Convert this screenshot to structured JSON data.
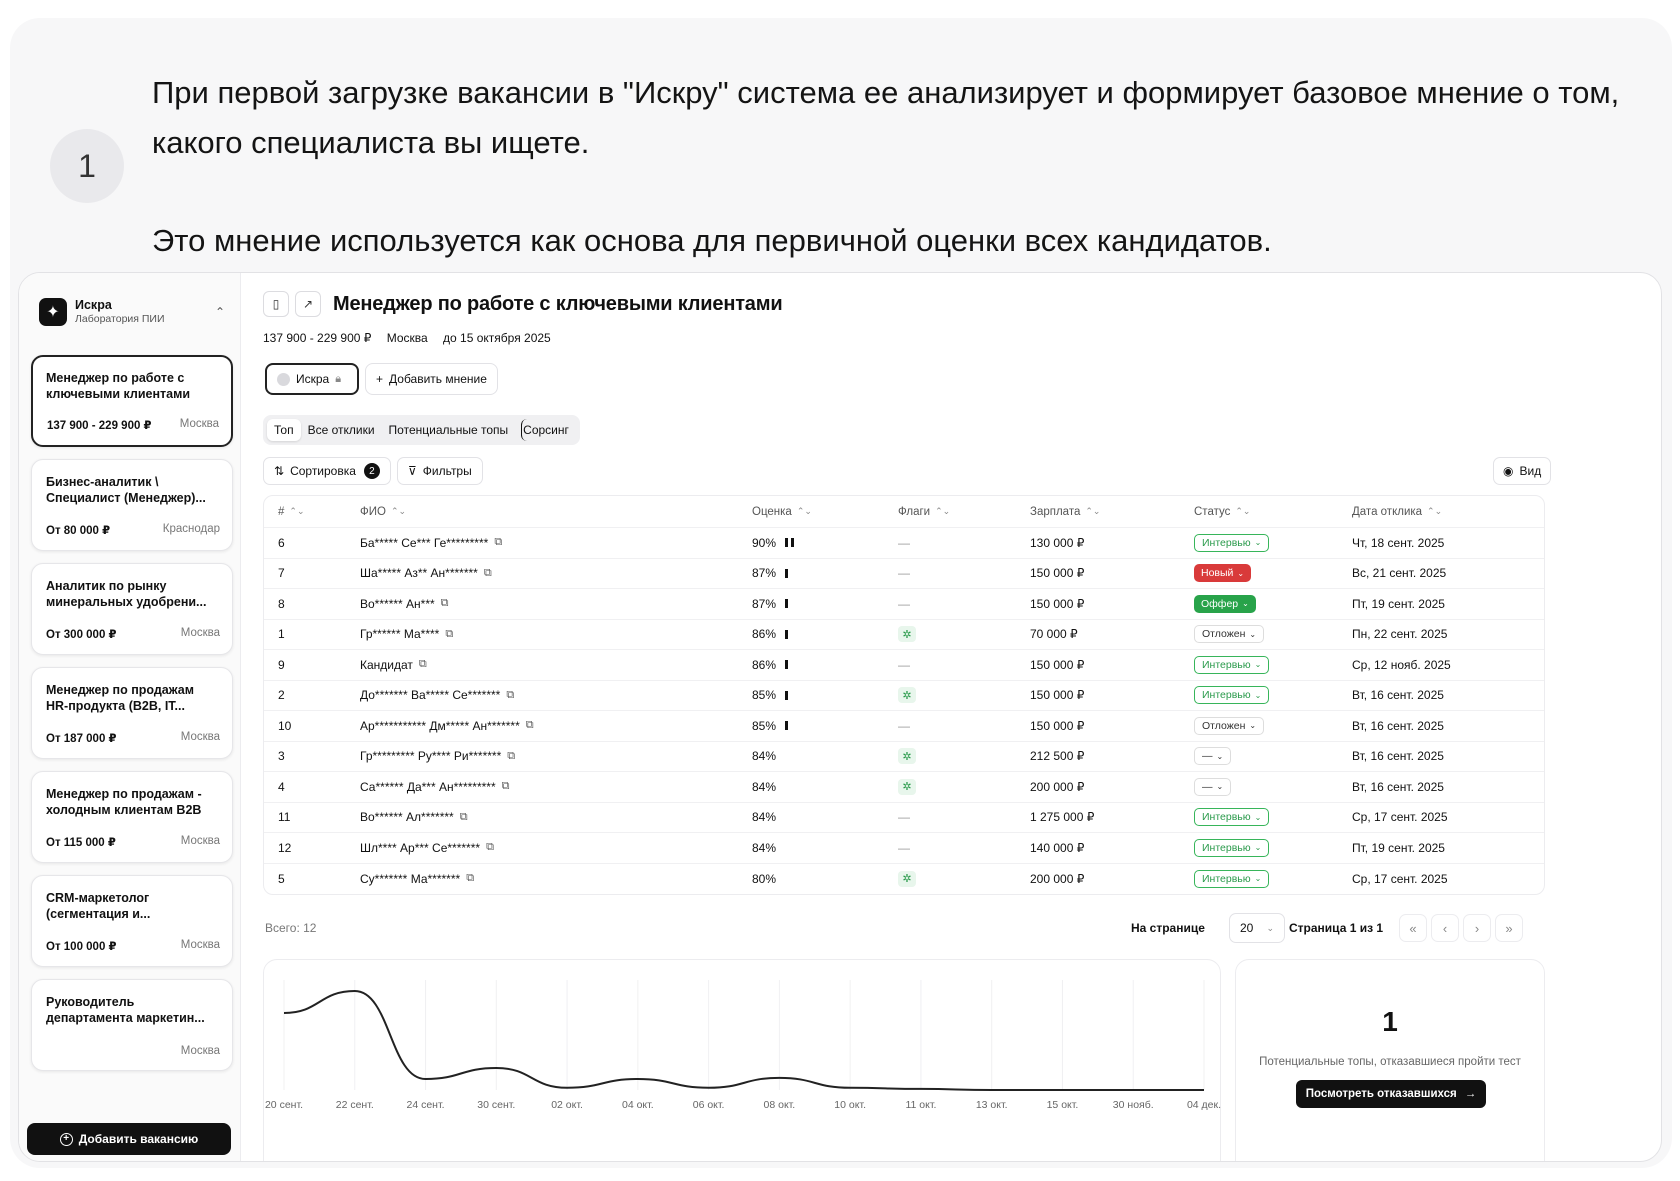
{
  "step": {
    "number": "1"
  },
  "intro": {
    "line1": "При первой загрузке вакансии в \"Искру\" система ее анализирует и формирует базовое мнение о том, какого специалиста вы ищете.",
    "line2": "Это мнение используется как основа для первичной оценки всех кандидатов."
  },
  "workspace": {
    "name": "Искра",
    "org": "Лаборатория ПИИ",
    "switch_icon": "chevrons-up-down-icon"
  },
  "vacancies": [
    {
      "title": "Менеджер по работе с ключевыми клиентами",
      "salary": "137 900 - 229 900 ₽",
      "city": "Москва",
      "active": true
    },
    {
      "title": "Бизнес-аналитик \\ Специалист (Менеджер)...",
      "salary": "От 80 000 ₽",
      "city": "Краснодар"
    },
    {
      "title": "Аналитик по рынку минеральных удобрени...",
      "salary": "От 300 000 ₽",
      "city": "Москва"
    },
    {
      "title": "Менеджер по продажам HR-продукта (B2B, IT...",
      "salary": "От 187 000 ₽",
      "city": "Москва"
    },
    {
      "title": "Менеджер по продажам - холодным клиентам B2B",
      "salary": "От 115 000 ₽",
      "city": "Москва"
    },
    {
      "title": "CRM-маркетолог (сегментация и...",
      "salary": "От 100 000 ₽",
      "city": "Москва"
    },
    {
      "title": "Руководитель департамента маркетин...",
      "salary": "",
      "city": "Москва"
    }
  ],
  "add_vacancy_label": "Добавить вакансию",
  "job": {
    "title": "Менеджер по работе с ключевыми клиентами",
    "salary": "137 900 - 229 900 ₽",
    "city": "Москва",
    "deadline": "до 15 октября 2025"
  },
  "opinions": {
    "selected": "Искра",
    "add_label": "Добавить мнение"
  },
  "tabs": [
    "Топ",
    "Все отклики",
    "Потенциальные топы",
    "Сорсинг"
  ],
  "controls": {
    "sort_label": "Сортировка",
    "sort_count": "2",
    "filter_label": "Фильтры",
    "view_label": "Вид"
  },
  "colors": {
    "interview": "#2a9a4b",
    "new": "#d93a3a",
    "offer": "#28a34a"
  },
  "table": {
    "headers": [
      "#",
      "ФИО",
      "Оценка",
      "Флаги",
      "Зарплата",
      "Статус",
      "Дата отклика"
    ],
    "rows": [
      {
        "n": "6",
        "name": "Ба***** Се*** Ге*********",
        "score": "90%",
        "bars": 2,
        "flag": false,
        "salary": "130 000 ₽",
        "status": "Интервью",
        "kind": "interview",
        "date": "Чт, 18 сент. 2025"
      },
      {
        "n": "7",
        "name": "Ша***** Аз** Ан*******",
        "score": "87%",
        "bars": 1,
        "flag": false,
        "salary": "150 000 ₽",
        "status": "Новый",
        "kind": "new",
        "date": "Вс, 21 сент. 2025"
      },
      {
        "n": "8",
        "name": "Во****** Ан***",
        "score": "87%",
        "bars": 1,
        "flag": false,
        "salary": "150 000 ₽",
        "status": "Оффер",
        "kind": "offer",
        "date": "Пт, 19 сент. 2025"
      },
      {
        "n": "1",
        "name": "Гр****** Ма****",
        "score": "86%",
        "bars": 1,
        "flag": true,
        "salary": "70 000 ₽",
        "status": "Отложен",
        "kind": "deferred",
        "date": "Пн, 22 сент. 2025"
      },
      {
        "n": "9",
        "name": "Кандидат",
        "score": "86%",
        "bars": 1,
        "flag": false,
        "salary": "150 000 ₽",
        "status": "Интервью",
        "kind": "interview",
        "date": "Ср, 12 нояб. 2025"
      },
      {
        "n": "2",
        "name": "До******* Ва***** Се*******",
        "score": "85%",
        "bars": 1,
        "flag": true,
        "salary": "150 000 ₽",
        "status": "Интервью",
        "kind": "interview",
        "date": "Вт, 16 сент. 2025"
      },
      {
        "n": "10",
        "name": "Ар*********** Дм***** Ан*******",
        "score": "85%",
        "bars": 1,
        "flag": false,
        "salary": "150 000 ₽",
        "status": "Отложен",
        "kind": "deferred",
        "date": "Вт, 16 сент. 2025"
      },
      {
        "n": "3",
        "name": "Гр********* Ру**** Ри*******",
        "score": "84%",
        "bars": 0,
        "flag": true,
        "salary": "212 500 ₽",
        "status": "—",
        "kind": "none",
        "date": "Вт, 16 сент. 2025"
      },
      {
        "n": "4",
        "name": "Са****** Да*** Ан*********",
        "score": "84%",
        "bars": 0,
        "flag": true,
        "salary": "200 000 ₽",
        "status": "—",
        "kind": "none",
        "date": "Вт, 16 сент. 2025"
      },
      {
        "n": "11",
        "name": "Во****** Ал*******",
        "score": "84%",
        "bars": 0,
        "flag": false,
        "salary": "1 275 000 ₽",
        "status": "Интервью",
        "kind": "interview",
        "date": "Ср, 17 сент. 2025"
      },
      {
        "n": "12",
        "name": "Шл**** Ар*** Се*******",
        "score": "84%",
        "bars": 0,
        "flag": false,
        "salary": "140 000 ₽",
        "status": "Интервью",
        "kind": "interview",
        "date": "Пт, 19 сент. 2025"
      },
      {
        "n": "5",
        "name": "Су******* Ма*******",
        "score": "80%",
        "bars": 0,
        "flag": true,
        "salary": "200 000 ₽",
        "status": "Интервью",
        "kind": "interview",
        "date": "Ср, 17 сент. 2025"
      }
    ]
  },
  "footer": {
    "total": "Всего: 12",
    "per_page_label": "На странице",
    "per_page": "20",
    "page_info": "Страница 1 из 1"
  },
  "chart_data": {
    "type": "line",
    "x": [
      "20 сент.",
      "22 сент.",
      "24 сент.",
      "30 сент.",
      "02 окт.",
      "04 окт.",
      "06 окт.",
      "08 окт.",
      "10 окт.",
      "11 окт.",
      "13 окт.",
      "15 окт.",
      "30 нояб.",
      "04 дек."
    ],
    "values": [
      7,
      9,
      1,
      2,
      0.2,
      1,
      0.2,
      1.1,
      0.2,
      0.1,
      0,
      0,
      0,
      0
    ],
    "xlabel": "",
    "ylabel": "",
    "grid": true
  },
  "kpi": {
    "value": "1",
    "label": "Потенциальные топы, отказавшиеся пройти тест",
    "button": "Посмотреть отказавшихся"
  }
}
